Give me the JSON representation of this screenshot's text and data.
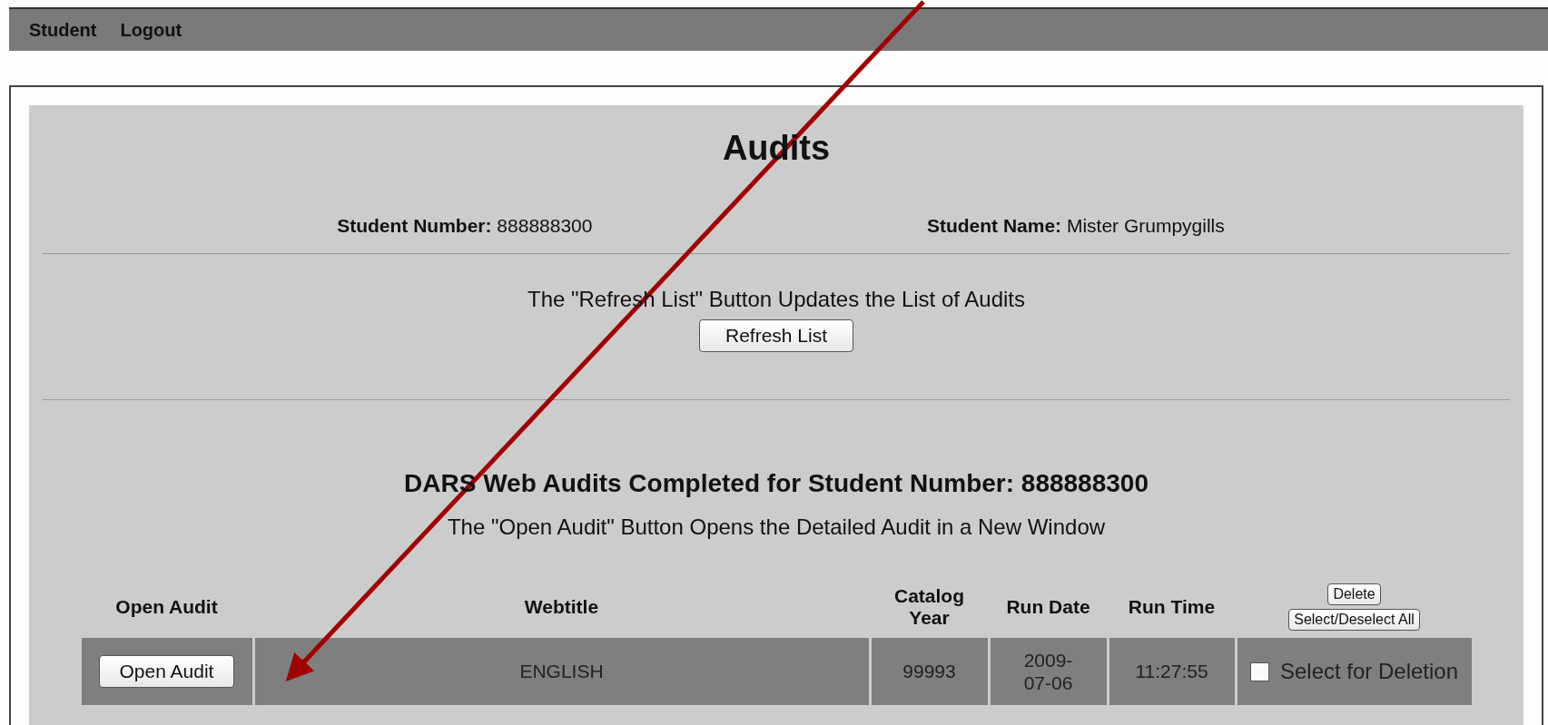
{
  "menu": [
    {
      "label": "Student"
    },
    {
      "label": "Logout"
    }
  ],
  "title": "Audits",
  "student": {
    "number_label": "Student Number:",
    "number": "888888300",
    "name_label": "Student Name:",
    "name": "Mister Grumpygills"
  },
  "refresh_note": "The \"Refresh List\" Button Updates the List of Audits",
  "refresh_button": "Refresh List",
  "heading": "DARS Web Audits Completed for Student Number: 888888300",
  "open_note": "The \"Open Audit\" Button Opens the Detailed Audit in a New Window",
  "table": {
    "columns": [
      "Open Audit",
      "Webtitle",
      "Catalog Year",
      "Run Date",
      "Run Time"
    ],
    "delete_button": "Delete",
    "select_all_button": "Select/Deselect All",
    "rows": [
      {
        "button": "Open Audit",
        "webtitle": "ENGLISH",
        "catalog_year": "99993",
        "run_date": "2009-07-06",
        "run_time": "11:27:55",
        "select_label": "Select for Deletion",
        "checked": false
      }
    ]
  }
}
